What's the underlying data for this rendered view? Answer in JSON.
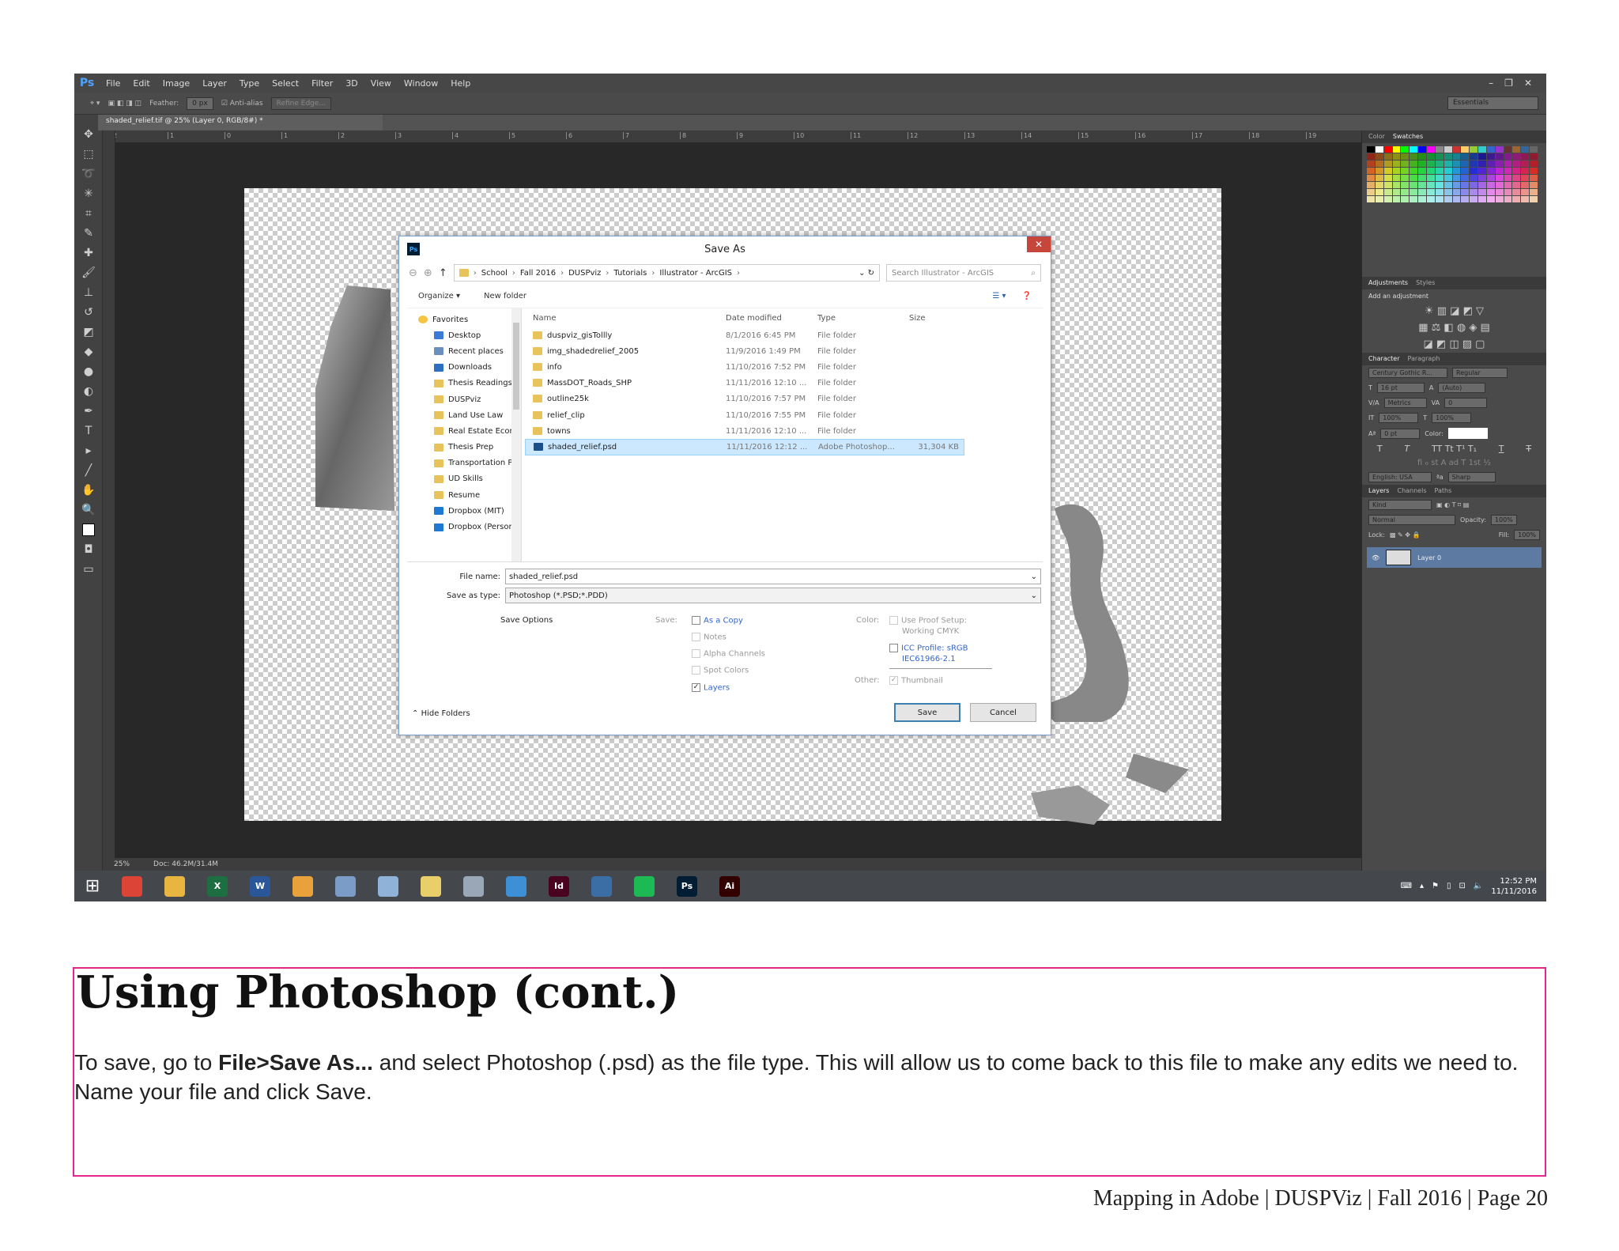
{
  "photoshop": {
    "logo": "Ps",
    "menu": [
      "File",
      "Edit",
      "Image",
      "Layer",
      "Type",
      "Select",
      "Filter",
      "3D",
      "View",
      "Window",
      "Help"
    ],
    "window_controls": [
      "–",
      "❐",
      "✕"
    ],
    "options": {
      "feather_label": "Feather:",
      "feather_value": "0 px",
      "anti_alias_label": "Anti-alias",
      "refine_edge": "Refine Edge...",
      "workspace": "Essentials"
    },
    "doc_tab": "shaded_relief.tif @ 25% (Layer 0, RGB/8#) *",
    "ruler_ticks": [
      "2",
      "1",
      "0",
      "1",
      "2",
      "3",
      "4",
      "5",
      "6",
      "7",
      "8",
      "9",
      "10",
      "11",
      "12",
      "13",
      "14",
      "15",
      "16",
      "17",
      "18",
      "19"
    ],
    "status": {
      "zoom": "25%",
      "doc": "Doc: 46.2M/31.4M"
    },
    "panels": {
      "color_tabs": [
        "Color",
        "Swatches"
      ],
      "adjustments_tabs": [
        "Adjustments",
        "Styles"
      ],
      "adjustments_title": "Add an adjustment",
      "character_tabs": [
        "Character",
        "Paragraph"
      ],
      "font_family": "Century Gothic R...",
      "font_style": "Regular",
      "font_size": "16 pt",
      "leading": "(Auto)",
      "kerning": "Metrics",
      "tracking": "0",
      "vscale": "100%",
      "hscale": "100%",
      "baseline": "0 pt",
      "color_label": "Color:",
      "language": "English: USA",
      "antialias": "Sharp",
      "layers_tabs": [
        "Layers",
        "Channels",
        "Paths"
      ],
      "kind": "Kind",
      "blend": "Normal",
      "opacity_label": "Opacity:",
      "opacity": "100%",
      "lock_label": "Lock:",
      "fill_label": "Fill:",
      "fill": "100%",
      "layer_name": "Layer 0"
    }
  },
  "dialog": {
    "title": "Save As",
    "breadcrumb": [
      "School",
      "Fall 2016",
      "DUSPviz",
      "Tutorials",
      "Illustrator - ArcGIS"
    ],
    "search_placeholder": "Search Illustrator - ArcGIS",
    "organize": "Organize ▾",
    "new_folder": "New folder",
    "nav_items": [
      {
        "label": "Favorites",
        "icon": "star-icon"
      },
      {
        "label": "Desktop",
        "icon": "desktop-icon"
      },
      {
        "label": "Recent places",
        "icon": "recent-places-icon"
      },
      {
        "label": "Downloads",
        "icon": "downloads-icon"
      },
      {
        "label": "Thesis Readings",
        "icon": "folder-icon"
      },
      {
        "label": "DUSPviz",
        "icon": "folder-icon"
      },
      {
        "label": "Land Use Law",
        "icon": "folder-icon"
      },
      {
        "label": "Real Estate Econ",
        "icon": "folder-icon"
      },
      {
        "label": "Thesis Prep",
        "icon": "folder-icon"
      },
      {
        "label": "Transportation P",
        "icon": "folder-icon"
      },
      {
        "label": "UD Skills",
        "icon": "folder-icon"
      },
      {
        "label": "Resume",
        "icon": "folder-icon"
      },
      {
        "label": "Dropbox (MIT)",
        "icon": "dropbox-icon"
      },
      {
        "label": "Dropbox (Person",
        "icon": "dropbox-icon"
      }
    ],
    "columns": [
      "Name",
      "Date modified",
      "Type",
      "Size"
    ],
    "files": [
      {
        "name": "duspviz_gisTollly",
        "date": "8/1/2016 6:45 PM",
        "type": "File folder",
        "size": ""
      },
      {
        "name": "img_shadedrelief_2005",
        "date": "11/9/2016 1:49 PM",
        "type": "File folder",
        "size": ""
      },
      {
        "name": "info",
        "date": "11/10/2016 7:52 PM",
        "type": "File folder",
        "size": ""
      },
      {
        "name": "MassDOT_Roads_SHP",
        "date": "11/11/2016 12:10 ...",
        "type": "File folder",
        "size": ""
      },
      {
        "name": "outline25k",
        "date": "11/10/2016 7:57 PM",
        "type": "File folder",
        "size": ""
      },
      {
        "name": "relief_clip",
        "date": "11/10/2016 7:55 PM",
        "type": "File folder",
        "size": ""
      },
      {
        "name": "towns",
        "date": "11/11/2016 12:10 ...",
        "type": "File folder",
        "size": ""
      },
      {
        "name": "shaded_relief.psd",
        "date": "11/11/2016 12:12 ...",
        "type": "Adobe Photoshop...",
        "size": "31,304 KB"
      }
    ],
    "file_name_label": "File name:",
    "file_name": "shaded_relief.psd",
    "save_as_type_label": "Save as type:",
    "save_as_type": "Photoshop (*.PSD;*.PDD)",
    "save_options": "Save Options",
    "save_label": "Save:",
    "opt_as_copy": "As a Copy",
    "opt_notes": "Notes",
    "opt_alpha": "Alpha Channels",
    "opt_spot": "Spot Colors",
    "opt_layers": "Layers",
    "color_label": "Color:",
    "opt_proof": "Use Proof Setup:",
    "opt_proof2": "Working CMYK",
    "opt_icc": "ICC Profile: sRGB",
    "opt_icc2": "IEC61966-2.1",
    "other_label": "Other:",
    "opt_thumbnail": "Thumbnail",
    "hide_folders": "Hide Folders",
    "save_button": "Save",
    "cancel_button": "Cancel"
  },
  "taskbar": {
    "apps": [
      {
        "name": "chrome-icon",
        "label": "",
        "color": "#db4437"
      },
      {
        "name": "file-explorer-icon",
        "label": "",
        "color": "#e8b640"
      },
      {
        "name": "excel-icon",
        "label": "X",
        "color": "#1d6f42"
      },
      {
        "name": "word-icon",
        "label": "W",
        "color": "#2b579a"
      },
      {
        "name": "app-diamond-icon",
        "label": "",
        "color": "#e9a23b"
      },
      {
        "name": "calculator-icon",
        "label": "",
        "color": "#7a9cc6"
      },
      {
        "name": "notes-icon",
        "label": "",
        "color": "#8fb2d8"
      },
      {
        "name": "folder-app-icon",
        "label": "",
        "color": "#e9cf6a"
      },
      {
        "name": "globe-app-icon",
        "label": "",
        "color": "#9aa7b6"
      },
      {
        "name": "ie-icon",
        "label": "",
        "color": "#3d8fd6"
      },
      {
        "name": "indesign-icon",
        "label": "Id",
        "color": "#49021f"
      },
      {
        "name": "search-app-icon",
        "label": "",
        "color": "#3b6ea5"
      },
      {
        "name": "spotify-icon",
        "label": "",
        "color": "#1db954"
      },
      {
        "name": "photoshop-icon",
        "label": "Ps",
        "color": "#001d34"
      },
      {
        "name": "illustrator-icon",
        "label": "Ai",
        "color": "#330000"
      }
    ],
    "time": "12:52 PM",
    "date": "11/11/2016"
  },
  "document": {
    "heading": "Using Photoshop (cont.)",
    "body_pre": "To save, go to ",
    "body_bold": "File>Save As...",
    "body_post": " and select Photoshop (.psd) as the file type. This will allow us to come back to this file to make any edits we need to. Name your file and click Save.",
    "footer": "Mapping in Adobe | DUSPViz | Fall 2016 | Page 20"
  },
  "colors": {
    "box_border": "#e3268c",
    "ps_bg": "#535353",
    "selection": "#cce8ff"
  }
}
